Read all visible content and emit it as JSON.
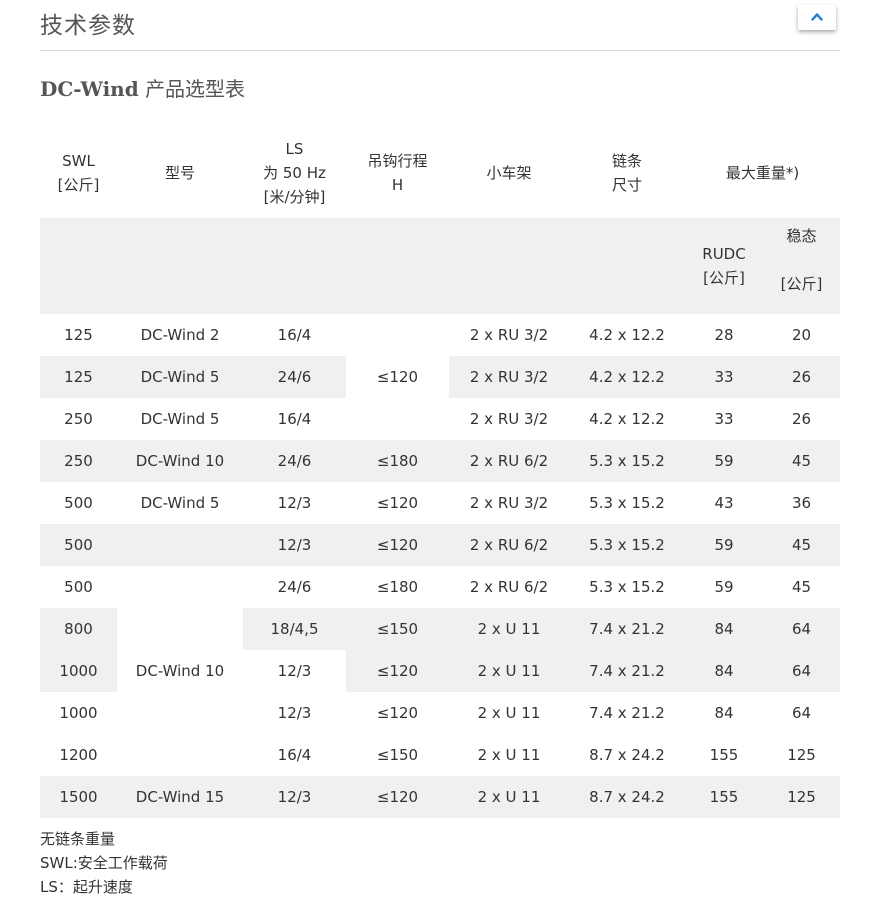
{
  "section_title": "技术参数",
  "collapse_icon": "chevron-up-icon",
  "accent_color": "#1a7ad4",
  "subtitle": {
    "brand": "DC-Wind",
    "rest": "产品选型表"
  },
  "headers": {
    "swl": [
      "SWL",
      "[公斤]"
    ],
    "model": "型号",
    "ls": [
      "LS",
      "为 50 Hz",
      "[米/分钟]"
    ],
    "hook": [
      "吊钩行程",
      "H"
    ],
    "trolley": "小车架",
    "chain": [
      "链条",
      "尺寸"
    ],
    "weight": "最大重量*)",
    "rudc": [
      "RUDC",
      "[公斤]"
    ],
    "steady": [
      "稳态",
      "",
      "[公斤]"
    ]
  },
  "rows": [
    {
      "swl": "125",
      "model": "DC-Wind 2",
      "ls": "16/4",
      "hook": "",
      "trolley": "2 x RU 3/2",
      "chain": "4.2 x 12.2",
      "rudc": "28",
      "steady": "20"
    },
    {
      "swl": "125",
      "model": "DC-Wind 5",
      "ls": "24/6",
      "hook": "≤120",
      "trolley": "2 x RU 3/2",
      "chain": "4.2 x 12.2",
      "rudc": "33",
      "steady": "26"
    },
    {
      "swl": "250",
      "model": "DC-Wind 5",
      "ls": "16/4",
      "hook": "",
      "trolley": "2 x RU 3/2",
      "chain": "4.2 x 12.2",
      "rudc": "33",
      "steady": "26"
    },
    {
      "swl": "250",
      "model": "DC-Wind 10",
      "ls": "24/6",
      "hook": "≤180",
      "trolley": "2 x RU 6/2",
      "chain": "5.3 x 15.2",
      "rudc": "59",
      "steady": "45"
    },
    {
      "swl": "500",
      "model": "DC-Wind 5",
      "ls": "12/3",
      "hook": "≤120",
      "trolley": "2 x RU 3/2",
      "chain": "5.3 x 15.2",
      "rudc": "43",
      "steady": "36"
    },
    {
      "swl": "500",
      "model": "",
      "ls": "12/3",
      "hook": "≤120",
      "trolley": "2 x RU 6/2",
      "chain": "5.3 x 15.2",
      "rudc": "59",
      "steady": "45"
    },
    {
      "swl": "500",
      "model": "",
      "ls": "24/6",
      "hook": "≤180",
      "trolley": "2 x RU 6/2",
      "chain": "5.3 x 15.2",
      "rudc": "59",
      "steady": "45"
    },
    {
      "swl": "800",
      "model": "DC-Wind 10",
      "ls": "18/4,5",
      "hook": "≤150",
      "trolley": "2 x U 11",
      "chain": "7.4 x 21.2",
      "rudc": "84",
      "steady": "64"
    },
    {
      "swl": "1000",
      "model": "",
      "ls": "12/3",
      "hook": "≤120",
      "trolley": "2 x U 11",
      "chain": "7.4 x 21.2",
      "rudc": "84",
      "steady": "64"
    },
    {
      "swl": "1000",
      "model": "",
      "ls": "12/3",
      "hook": "≤120",
      "trolley": "2 x U 11",
      "chain": "7.4 x 21.2",
      "rudc": "84",
      "steady": "64"
    },
    {
      "swl": "1200",
      "model": "",
      "ls": "16/4",
      "hook": "≤150",
      "trolley": "2 x U 11",
      "chain": "8.7 x 24.2",
      "rudc": "155",
      "steady": "125"
    },
    {
      "swl": "1500",
      "model": "DC-Wind 15",
      "ls": "12/3",
      "hook": "≤120",
      "trolley": "2 x U 11",
      "chain": "8.7 x 24.2",
      "rudc": "155",
      "steady": "125"
    }
  ],
  "notes": [
    "无链条重量",
    "SWL:安全工作载荷",
    "LS：起升速度"
  ]
}
